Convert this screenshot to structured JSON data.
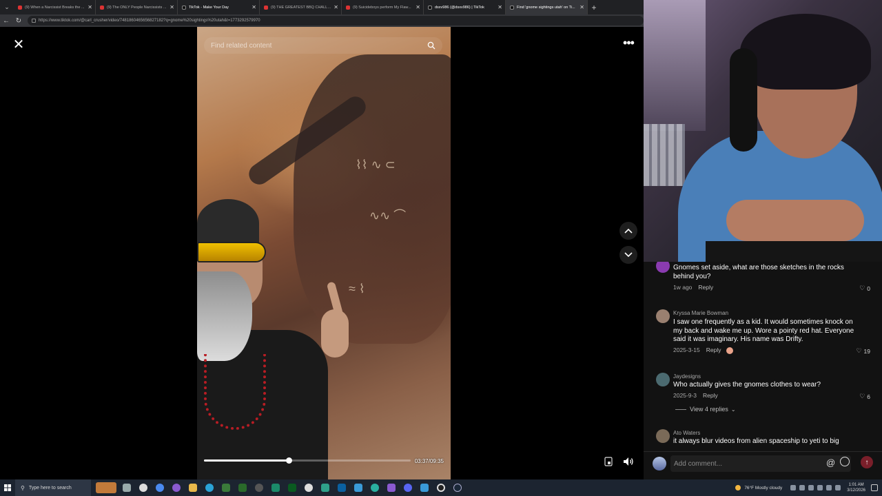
{
  "browser": {
    "tabs": [
      {
        "title": "(9) When a Narcissist Breaks the ...",
        "icon": "youtube-icon",
        "active": false
      },
      {
        "title": "(9) The ONLY People Narcissists ...",
        "icon": "youtube-icon",
        "active": false
      },
      {
        "title": "TikTok - Make Your Day",
        "icon": "tiktok-icon",
        "active": false
      },
      {
        "title": "(9) THE GREATEST BBQ CHALLEN...",
        "icon": "youtube-icon",
        "active": false
      },
      {
        "title": "(9) Suicideboys perform My Flaw...",
        "icon": "youtube-icon",
        "active": false
      },
      {
        "title": "dsxv986 (@dsxv986) | TikTok",
        "icon": "tiktok-icon",
        "active": false
      },
      {
        "title": "Find 'gnome sightings utah' on Ti...",
        "icon": "tiktok-icon",
        "active": true
      }
    ],
    "url": "https://www.tiktok.com/@carl_crusher/video/7481860465656827182?q=gnome%20sightings%20utah&t=1773292579970"
  },
  "viewer": {
    "search_placeholder": "Find related content",
    "time": "03:37/09:35",
    "progress": 0.41
  },
  "comments": [
    {
      "user": "",
      "text": "Gnomes set aside, what are those sketches in the rocks behind you?",
      "date": "1w ago",
      "reply": "Reply",
      "likes": "0",
      "avatar_color": "#8a3bb0"
    },
    {
      "user": "Kryssa Marie Bowman",
      "text": "I saw one frequently as a kid. It would sometimes knock on my back and wake me up. Wore a pointy red hat. Everyone said it was imaginary. His name was Drifty.",
      "date": "2025-3-15",
      "reply": "Reply",
      "likes": "19",
      "avatar_color": "#9a8070"
    },
    {
      "user": "Jaydesigns",
      "text": "Who actually gives the gnomes clothes to wear?",
      "date": "2025-9-3",
      "reply": "Reply",
      "likes": "6",
      "avatar_color": "#4b6a70"
    },
    {
      "user": "Ato Waters",
      "text": "it always blur videos from alien spaceship to yeti to big",
      "date": "",
      "reply": "",
      "likes": "",
      "avatar_color": "#7a6a58"
    }
  ],
  "view_replies": "View 4 replies",
  "comment_input": {
    "placeholder": "Add comment..."
  },
  "taskbar": {
    "search_placeholder": "Type here to search",
    "weather": "76°F  Mostly cloudy",
    "time": "1:01 AM",
    "date": "3/12/2026"
  }
}
